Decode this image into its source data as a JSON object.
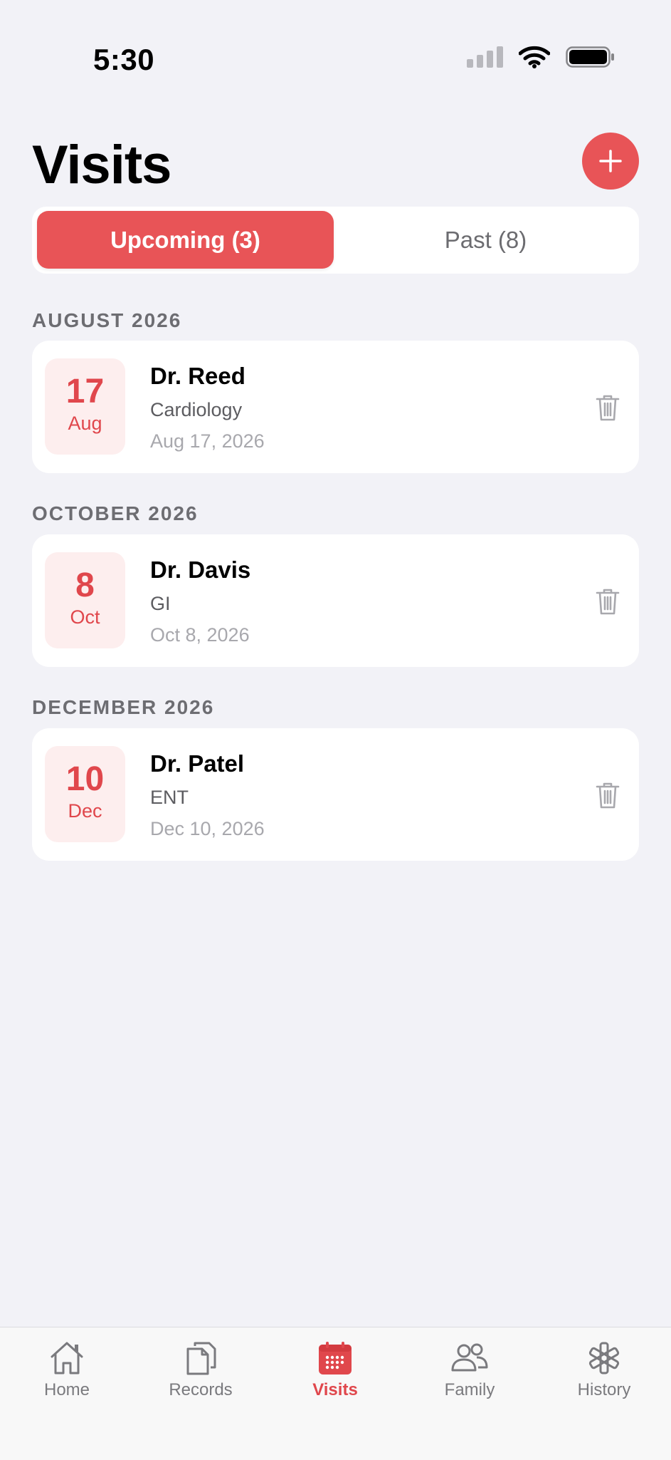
{
  "status_bar": {
    "time": "5:30"
  },
  "header": {
    "title": "Visits",
    "add_icon": "plus-icon"
  },
  "segments": {
    "upcoming": "Upcoming (3)",
    "past": "Past (8)"
  },
  "sections": [
    {
      "header": "AUGUST 2026",
      "visit": {
        "day": "17",
        "month": "Aug",
        "doctor": "Dr. Reed",
        "specialty": "Cardiology",
        "date": "Aug 17, 2026"
      }
    },
    {
      "header": "OCTOBER 2026",
      "visit": {
        "day": "8",
        "month": "Oct",
        "doctor": "Dr. Davis",
        "specialty": "GI",
        "date": "Oct 8, 2026"
      }
    },
    {
      "header": "DECEMBER 2026",
      "visit": {
        "day": "10",
        "month": "Dec",
        "doctor": "Dr. Patel",
        "specialty": "ENT",
        "date": "Dec 10, 2026"
      }
    }
  ],
  "tab_bar": {
    "items": [
      {
        "label": "Home",
        "icon": "house-icon"
      },
      {
        "label": "Records",
        "icon": "documents-icon"
      },
      {
        "label": "Visits",
        "icon": "calendar-icon",
        "active": true
      },
      {
        "label": "Family",
        "icon": "people-icon"
      },
      {
        "label": "History",
        "icon": "medical-star-icon"
      }
    ]
  },
  "colors": {
    "accent": "#E85457",
    "background": "#F2F2F7",
    "badge_bg": "#FDEEEE"
  }
}
